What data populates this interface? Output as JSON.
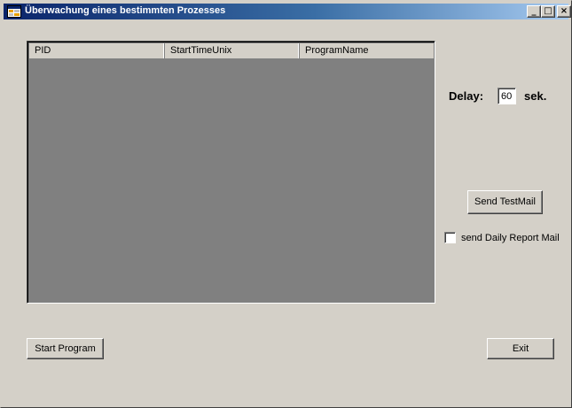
{
  "window": {
    "title": "Überwachung eines bestimmten Prozesses",
    "minimize_glyph": "_",
    "maximize_glyph": "□",
    "close_glyph": "×"
  },
  "listview": {
    "columns": [
      "PID",
      "StartTimeUnix",
      "ProgramName"
    ],
    "rows": []
  },
  "delay": {
    "label": "Delay:",
    "value": "60",
    "unit": "sek."
  },
  "buttons": {
    "send_testmail": "Send TestMail",
    "start_program": "Start Program",
    "exit": "Exit"
  },
  "daily_report": {
    "label": "send Daily Report Mail",
    "checked": false
  },
  "colors": {
    "window_bg": "#d4d0c8",
    "titlebar_start": "#0a246a",
    "titlebar_end": "#a6caf0",
    "listview_bg": "#808080"
  }
}
